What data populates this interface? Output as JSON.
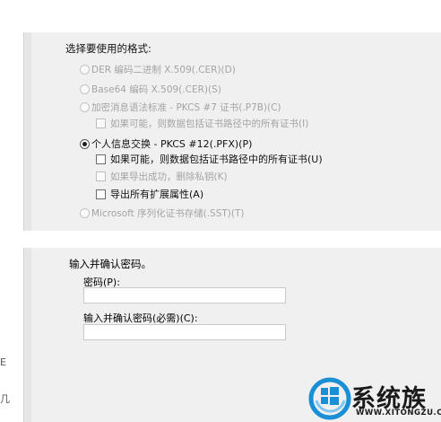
{
  "export_format": {
    "title": "选择要使用的格式:",
    "options": [
      {
        "label": "DER 编码二进制 X.509(.CER)(D)",
        "selected": false,
        "enabled": false
      },
      {
        "label": "Base64 编码 X.509(.CER)(S)",
        "selected": false,
        "enabled": false
      },
      {
        "label": "加密消息语法标准 - PKCS #7 证书(.P7B)(C)",
        "selected": false,
        "enabled": false
      },
      {
        "label": "个人信息交换 - PKCS #12(.PFX)(P)",
        "selected": true,
        "enabled": true
      },
      {
        "label": "Microsoft 序列化证书存储(.SST)(T)",
        "selected": false,
        "enabled": false
      }
    ],
    "pkcs7_include_chain": {
      "label": "如果可能，则数据包括证书路径中的所有证书(I)",
      "checked": false,
      "enabled": false
    },
    "pfx_include_chain": {
      "label": "如果可能，则数据包括证书路径中的所有证书(U)",
      "checked": false,
      "enabled": true
    },
    "delete_private_key": {
      "label": "如果导出成功，删除私钥(K)",
      "checked": false,
      "enabled": false
    },
    "export_all_props": {
      "label": "导出所有扩展属性(A)",
      "checked": false,
      "enabled": true
    }
  },
  "password": {
    "title": "输入并确认密码。",
    "password_label": "密码(P):",
    "password_value": "",
    "confirm_label": "输入并确认密码(必需)(C):",
    "confirm_value": ""
  },
  "edge_glyphs": [
    "E",
    "几"
  ],
  "watermark": {
    "brand": "系统族",
    "url": "WWW.XITONGZU.COM",
    "colors": {
      "ring": "#1b8fd6",
      "windows": "#1b8fd6"
    }
  }
}
